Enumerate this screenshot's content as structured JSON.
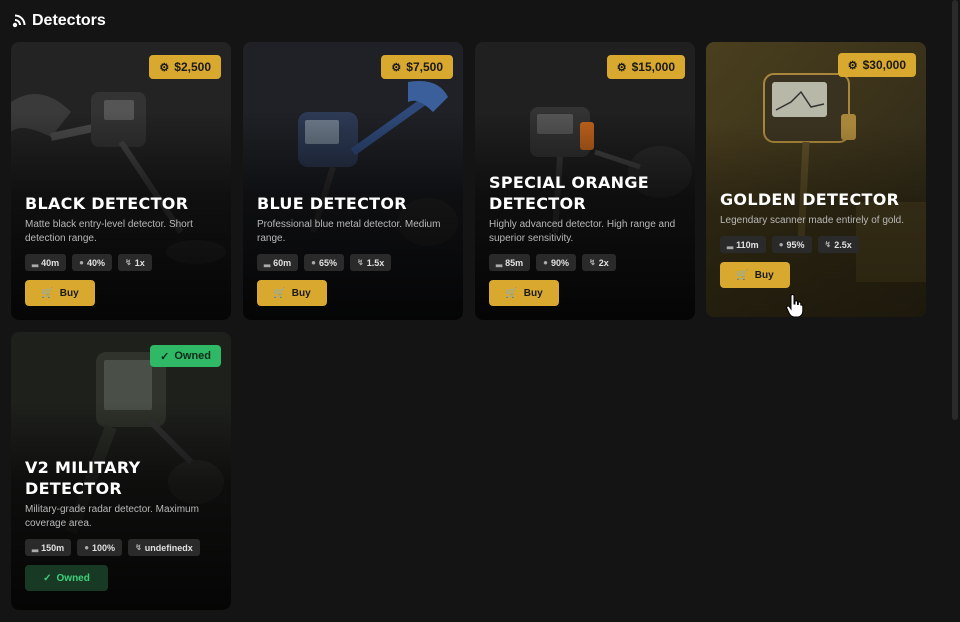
{
  "header": {
    "title": "Detectors",
    "icon": "radar-icon"
  },
  "colors": {
    "accent": "#d9a82e",
    "owned": "#2fb866",
    "background": "#141414"
  },
  "detectors": [
    {
      "name": "BLACK DETECTOR",
      "description": "Matte black entry-level detector. Short detection range.",
      "price": "$2,500",
      "stats": {
        "range": "40m",
        "accuracy": "40%",
        "speed": "1x"
      },
      "action": "Buy"
    },
    {
      "name": "BLUE DETECTOR",
      "description": "Professional blue metal detector. Medium range.",
      "price": "$7,500",
      "stats": {
        "range": "60m",
        "accuracy": "65%",
        "speed": "1.5x"
      },
      "action": "Buy"
    },
    {
      "name": "SPECIAL ORANGE DETECTOR",
      "description": "Highly advanced detector. High range and superior sensitivity.",
      "price": "$15,000",
      "stats": {
        "range": "85m",
        "accuracy": "90%",
        "speed": "2x"
      },
      "action": "Buy"
    },
    {
      "name": "GOLDEN DETECTOR",
      "description": "Legendary scanner made entirely of gold.",
      "price": "$30,000",
      "stats": {
        "range": "110m",
        "accuracy": "95%",
        "speed": "2.5x"
      },
      "action": "Buy"
    },
    {
      "name": "V2 MILITARY DETECTOR",
      "description": "Military-grade radar detector. Maximum coverage area.",
      "badge": "Owned",
      "stats": {
        "range": "150m",
        "accuracy": "100%",
        "speed": "undefinedx"
      },
      "action": "Owned"
    }
  ]
}
